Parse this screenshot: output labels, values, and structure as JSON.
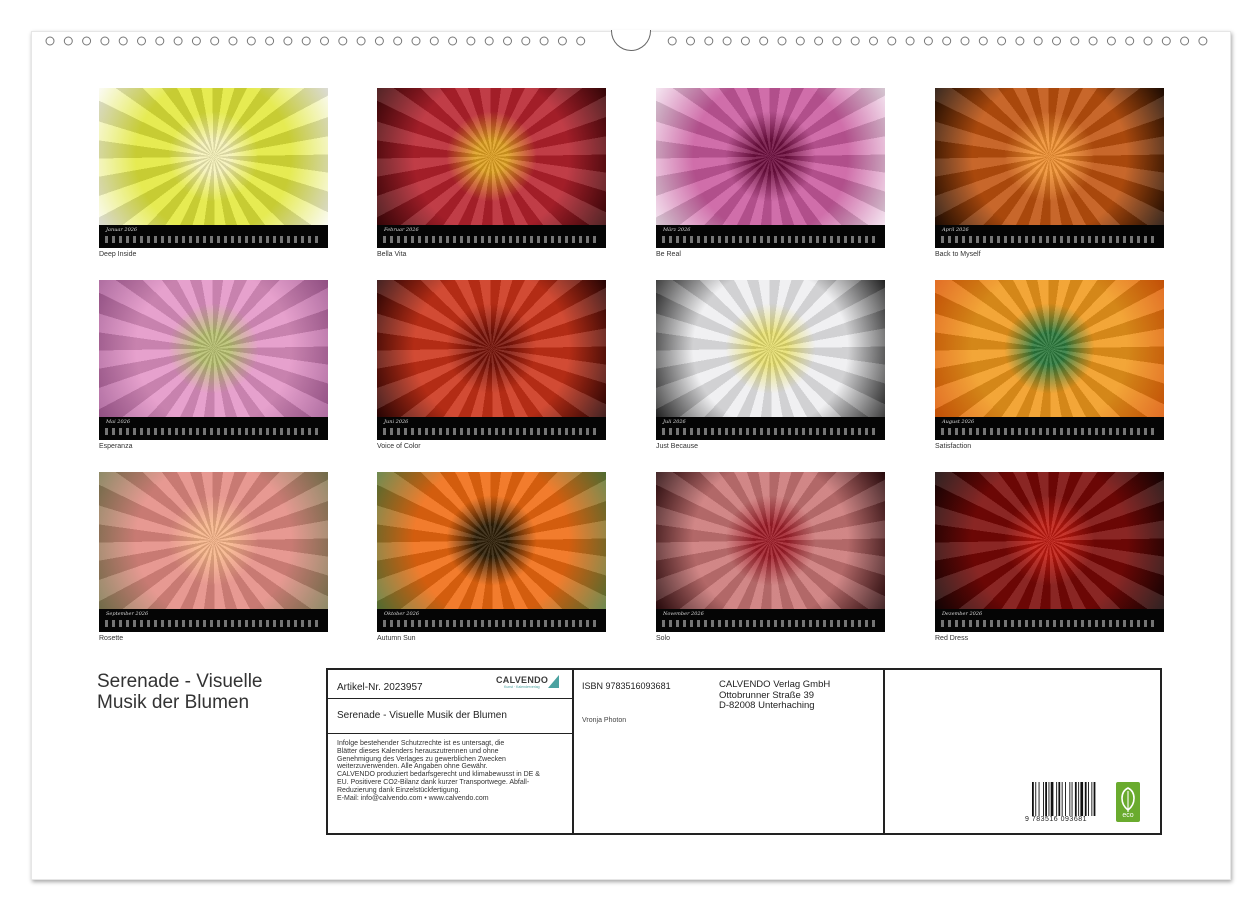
{
  "title": {
    "line1": "Serenade - Visuelle",
    "line2": "Musik der Blumen"
  },
  "months": [
    {
      "label": "Januar 2026",
      "caption": "Deep Inside",
      "colors": [
        "#f6f2b8",
        "#e2e83a",
        "#fafaf4"
      ]
    },
    {
      "label": "Februar 2026",
      "caption": "Bella Vita",
      "colors": [
        "#e0a020",
        "#b8222e",
        "#3a0608"
      ]
    },
    {
      "label": "März 2026",
      "caption": "Be Real",
      "colors": [
        "#700f40",
        "#c95a9e",
        "#f3e3ef"
      ]
    },
    {
      "label": "April 2026",
      "caption": "Back to Myself",
      "colors": [
        "#f09030",
        "#c0520e",
        "#1e0c02"
      ]
    },
    {
      "label": "Mai 2026",
      "caption": "Esperanza",
      "colors": [
        "#b8c070",
        "#e394c6",
        "#a45a94"
      ]
    },
    {
      "label": "Juni 2026",
      "caption": "Voice of Color",
      "colors": [
        "#781208",
        "#cc3218",
        "#2a0404"
      ]
    },
    {
      "label": "Juli 2026",
      "caption": "Just Because",
      "colors": [
        "#e8e070",
        "#eeeef0",
        "#252525"
      ]
    },
    {
      "label": "August 2026",
      "caption": "Satisfaction",
      "colors": [
        "#2c7a3c",
        "#f19a1c",
        "#dd5a08"
      ]
    },
    {
      "label": "September 2026",
      "caption": "Rosette",
      "colors": [
        "#f7b489",
        "#e48b83",
        "#7e7a52"
      ]
    },
    {
      "label": "Oktober 2026",
      "caption": "Autumn Sun",
      "colors": [
        "#2e1e06",
        "#f06a10",
        "#5a7a38"
      ]
    },
    {
      "label": "November 2026",
      "caption": "Solo",
      "colors": [
        "#a01c28",
        "#cb7676",
        "#2a0a0c"
      ]
    },
    {
      "label": "Dezember 2026",
      "caption": "Red Dress",
      "colors": [
        "#c01a10",
        "#7a0806",
        "#120404"
      ]
    }
  ],
  "info": {
    "article": "Artikel-Nr. 2023957",
    "brand": "CALVENDO",
    "brand_sub": "Kunst · Kalenderverlag",
    "calendar_title": "Serenade - Visuelle Musik der Blumen",
    "legal": [
      "Infolge bestehender Schutzrechte ist es untersagt, die",
      "Blätter dieses Kalenders herauszutrennen und ohne",
      "Genehmigung des Verlages zu gewerblichen Zwecken",
      "weiterzuverwenden. Alle Angaben ohne Gewähr.",
      "CALVENDO produziert bedarfsgerecht und klimabewusst in DE &",
      "EU. Positivere CO2-Bilanz dank kurzer Transportwege. Abfall-",
      "Reduzierung dank Einzelstückfertigung.",
      "E-Mail: info@calvendo.com • www.calvendo.com"
    ],
    "isbn": "ISBN 9783516093681",
    "author": "Vronja Photon",
    "publisher": [
      "CALVENDO Verlag GmbH",
      "Ottobrunner Straße 39",
      "D-82008 Unterhaching"
    ],
    "barcode_text": "9 783516 093681",
    "eco_label": "eco"
  }
}
